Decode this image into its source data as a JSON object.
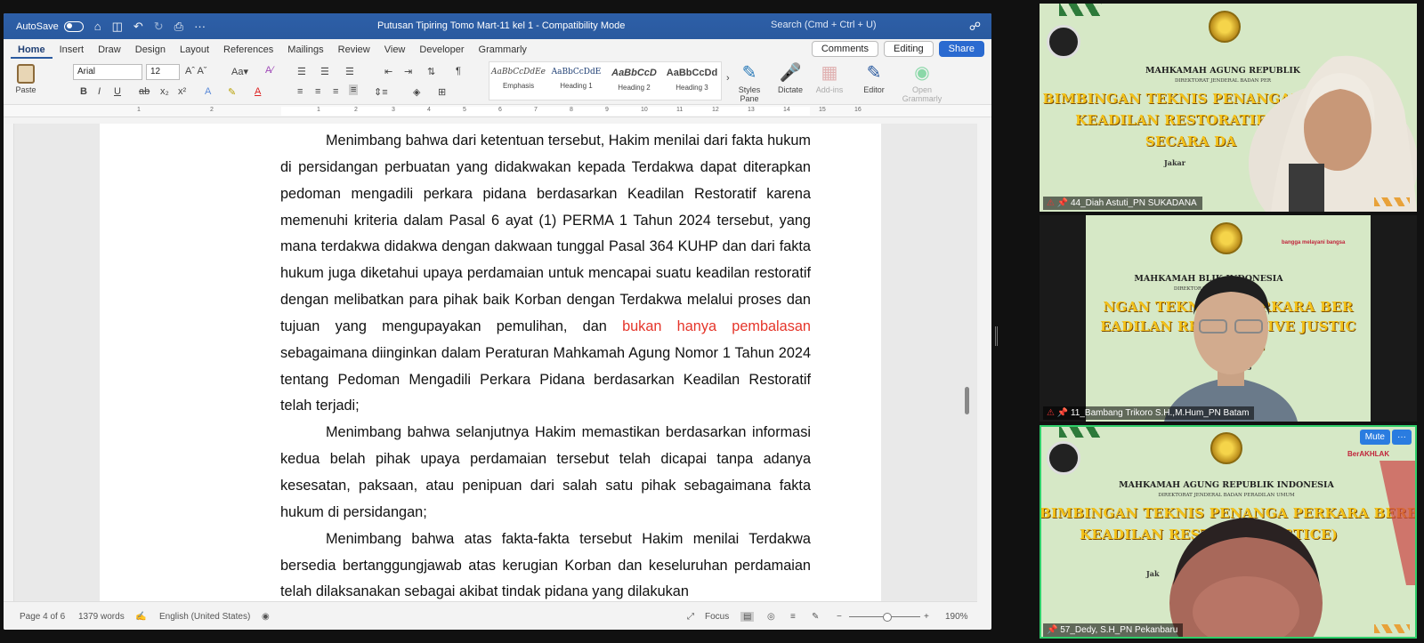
{
  "word": {
    "titlebar": {
      "autosave": "AutoSave",
      "title": "Putusan Tipiring Tomo Mart-11 kel 1  -  Compatibility Mode",
      "search_placeholder": "Search (Cmd + Ctrl + U)"
    },
    "tabs": [
      "Home",
      "Insert",
      "Draw",
      "Design",
      "Layout",
      "References",
      "Mailings",
      "Review",
      "View",
      "Developer",
      "Grammarly"
    ],
    "tabs_right": {
      "comments": "Comments",
      "editing": "Editing",
      "share": "Share"
    },
    "ribbon": {
      "paste": "Paste",
      "font_name": "Arial",
      "font_size": "12",
      "styles": [
        {
          "sample": "AaBbCcDdEe",
          "label": "Emphasis"
        },
        {
          "sample": "AaBbCcDdE",
          "label": "Heading 1"
        },
        {
          "sample": "AaBbCcD",
          "label": "Heading 2"
        },
        {
          "sample": "AaBbCcDd",
          "label": "Heading 3"
        }
      ],
      "styles_pane": "Styles Pane",
      "dictate": "Dictate",
      "addins": "Add-ins",
      "editor": "Editor",
      "open_grammarly": "Open Grammarly"
    },
    "ruler_ticks": [
      "1",
      "2",
      "1",
      "2",
      "3",
      "4",
      "5",
      "6",
      "7",
      "8",
      "9",
      "10",
      "11",
      "12",
      "13",
      "14",
      "15",
      "16"
    ],
    "document": {
      "p1": "Menimbang bahwa dari ketentuan tersebut, Hakim menilai dari fakta hukum di persidangan perbuatan yang didakwakan kepada Terdakwa dapat diterapkan pedoman mengadili perkara pidana berdasarkan Keadilan Restoratif karena memenuhi kriteria dalam Pasal 6 ayat (1) PERMA 1 Tahun 2024 tersebut, yang mana terdakwa didakwa dengan dakwaan tunggal Pasal 364 KUHP dan dari fakta hukum juga diketahui upaya perdamaian untuk mencapai suatu keadilan restoratif dengan melibatkan para pihak baik Korban dengan Terdakwa melalui proses dan tujuan yang mengupayakan pemulihan, dan ",
      "p1_red": "bukan hanya pembalasan",
      "p1_end": " sebagaimana diinginkan dalam Peraturan Mahkamah Agung Nomor 1 Tahun 2024 tentang Pedoman Mengadili Perkara Pidana berdasarkan Keadilan Restoratif telah terjadi;",
      "p2": "Menimbang bahwa selanjutnya Hakim memastikan berdasarkan informasi kedua belah pihak upaya perdamaian tersebut telah dicapai tanpa adanya kesesatan, paksaan, atau penipuan dari salah satu pihak sebagaimana fakta hukum di persidangan;",
      "p3": "Menimbang bahwa atas fakta-fakta tersebut Hakim menilai Terdakwa bersedia bertanggungjawab atas kerugian Korban dan keseluruhan perdamaian telah dilaksanakan sebagai akibat tindak pidana yang dilakukan"
    },
    "status": {
      "page": "Page 4 of 6",
      "words": "1379 words",
      "language": "English (United States)",
      "focus": "Focus",
      "zoom": "190%"
    }
  },
  "tiles": [
    {
      "name": "44_Diah Astuti_PN SUKADANA",
      "heading": "MAHKAMAH AGUNG REPUBLIK",
      "sub": "DIREKTORAT JENDERAL BADAN PER",
      "yellow": [
        "BIMBINGAN TEKNIS PENANGAN",
        "KEADILAN RESTORATIF (R",
        "SECARA DA"
      ],
      "place": "Jakar"
    },
    {
      "name": "11_Bambang Trikoro S.H.,M.Hum_PN Batam",
      "heading": "MAHKAMAH          BLIK INDONESIA",
      "sub": "DIREKTORA                    DILAN UMUM",
      "yellow": [
        "NGAN TEKNIS          N PERKARA BER",
        "EADILAN REST            ORATIVE JUSTIC",
        "NG"
      ],
      "place": "Jal                         2025",
      "logo": "bangga melayani bangsa"
    },
    {
      "name": "57_Dedy, S.H_PN Pekanbaru",
      "heading": "MAHKAMAH AGUNG REPUBLIK INDONESIA",
      "sub": "DIREKTORAT JENDERAL BADAN PERADILAN UMUM",
      "yellow": [
        "BIMBINGAN TEKNIS PENANGA        PERKARA BERBA   IS",
        "KEADILAN RESTOR              VE JUSTICE)",
        "SE"
      ],
      "place": "Jak",
      "logo": "BerAKHLAK",
      "mute": "Mute",
      "more": "···"
    }
  ],
  "colors": {
    "word_blue": "#2a5a9f",
    "highlight_red": "#e5352a",
    "active_speaker": "#2fcf6a",
    "banner_yellow": "#f4c21a"
  }
}
